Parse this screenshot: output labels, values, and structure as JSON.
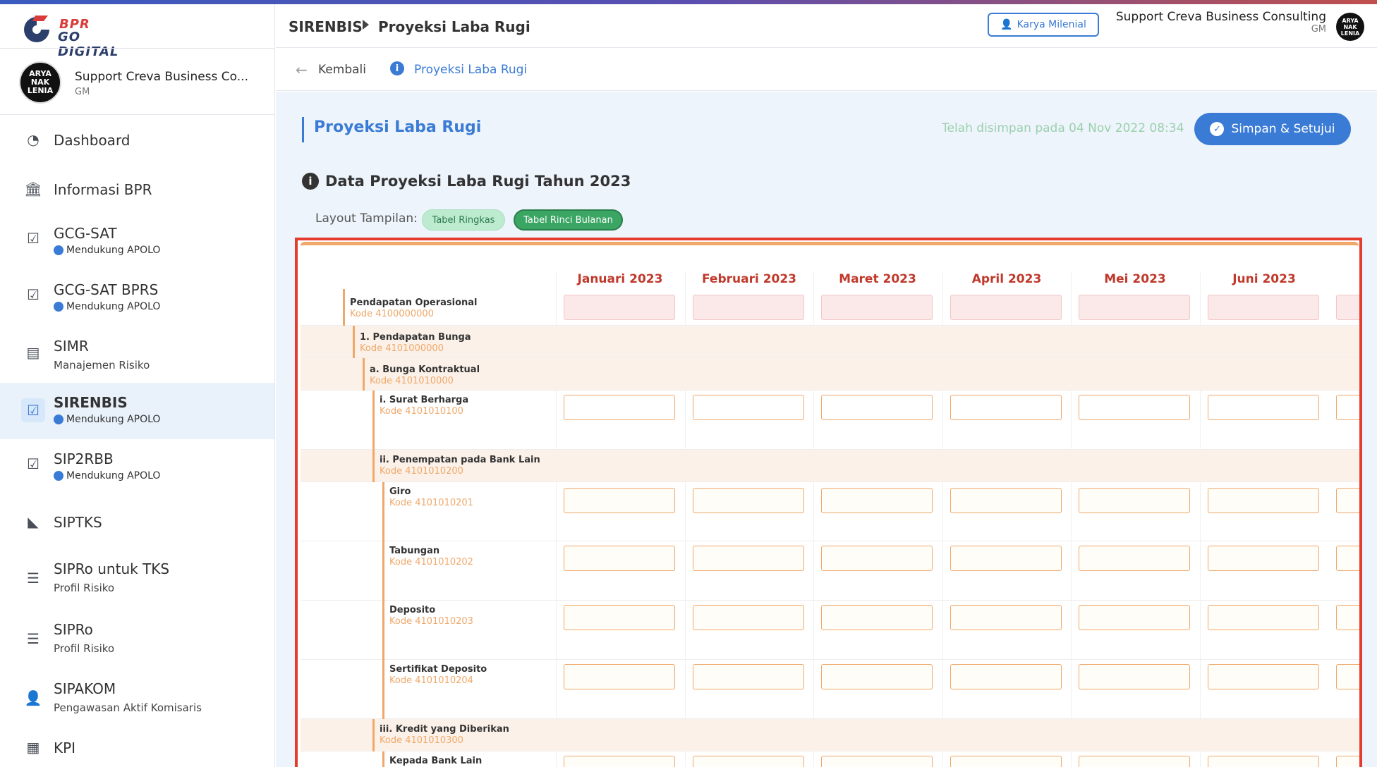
{
  "app": {
    "logo_line1": "BPR",
    "logo_line2": "GO DIGITAL",
    "avatar_text": "ARYA NAK LENIA"
  },
  "sidebar": {
    "user_name": "Support Creva Business Co...",
    "user_role": "GM",
    "items": [
      {
        "label": "Dashboard",
        "icon": "dashboard-gauge-icon"
      },
      {
        "label": "Informasi BPR",
        "icon": "bank-icon"
      },
      {
        "label": "GCG-SAT",
        "badge": "Mendukung APOLO",
        "icon": "clipboard-check-icon"
      },
      {
        "label": "GCG-SAT BPRS",
        "badge": "Mendukung APOLO",
        "icon": "clipboard-check-icon"
      },
      {
        "label": "SIMR",
        "sub": "Manajemen Risiko",
        "icon": "document-icon"
      },
      {
        "label": "SIRENBIS",
        "badge": "Mendukung APOLO",
        "icon": "clipboard-check-icon",
        "active": true
      },
      {
        "label": "SIP2RBB",
        "badge": "Mendukung APOLO",
        "icon": "clipboard-check-icon"
      },
      {
        "label": "SIPTKS",
        "icon": "area-chart-icon"
      },
      {
        "label": "SIPRo untuk TKS",
        "sub": "Profil Risiko",
        "icon": "checklist-icon"
      },
      {
        "label": "SIPRo",
        "sub": "Profil Risiko",
        "icon": "checklist-icon"
      },
      {
        "label": "SIPAKOM",
        "sub": "Pengawasan Aktif Komisaris",
        "icon": "user-gear-icon"
      },
      {
        "label": "KPI",
        "icon": "clipboard-list-icon"
      }
    ]
  },
  "header": {
    "crumb1": "SIRENBIS",
    "crumb2": "Proyeksi Laba Rugi",
    "karya_button": "Karya Milenial",
    "user_name": "Support Creva Business Consulting",
    "user_role": "GM"
  },
  "subheader": {
    "back_label": "Kembali",
    "title": "Proyeksi Laba Rugi"
  },
  "main": {
    "page_title": "Proyeksi Laba Rugi",
    "saved_text": "Telah disimpan pada 04 Nov 2022 08:34",
    "save_button": "Simpan & Setujui",
    "section_title": "Data Proyeksi Laba Rugi Tahun 2023",
    "layout_label": "Layout Tampilan:",
    "layout_options": [
      "Tabel Ringkas",
      "Tabel Rinci Bulanan"
    ]
  },
  "table": {
    "months": [
      "Januari 2023",
      "Februari 2023",
      "Maret 2023",
      "April 2023",
      "Mei 2023",
      "Juni 2023"
    ],
    "rows": [
      {
        "name": "Pendapatan Operasional",
        "code": "Kode 4100000000"
      },
      {
        "name": "1. Pendapatan Bunga",
        "code": "Kode 4101000000"
      },
      {
        "name": "a. Bunga Kontraktual",
        "code": "Kode 4101010000"
      },
      {
        "name": "i. Surat Berharga",
        "code": "Kode 4101010100"
      },
      {
        "name": "ii. Penempatan pada Bank Lain",
        "code": "Kode 4101010200"
      },
      {
        "name": "Giro",
        "code": "Kode 4101010201"
      },
      {
        "name": "Tabungan",
        "code": "Kode 4101010202"
      },
      {
        "name": "Deposito",
        "code": "Kode 4101010203"
      },
      {
        "name": "Sertifikat Deposito",
        "code": "Kode 4101010204"
      },
      {
        "name": "iii. Kredit yang Diberikan",
        "code": "Kode 4101010300"
      },
      {
        "name": "Kepada Bank Lain",
        "code": ""
      }
    ]
  }
}
